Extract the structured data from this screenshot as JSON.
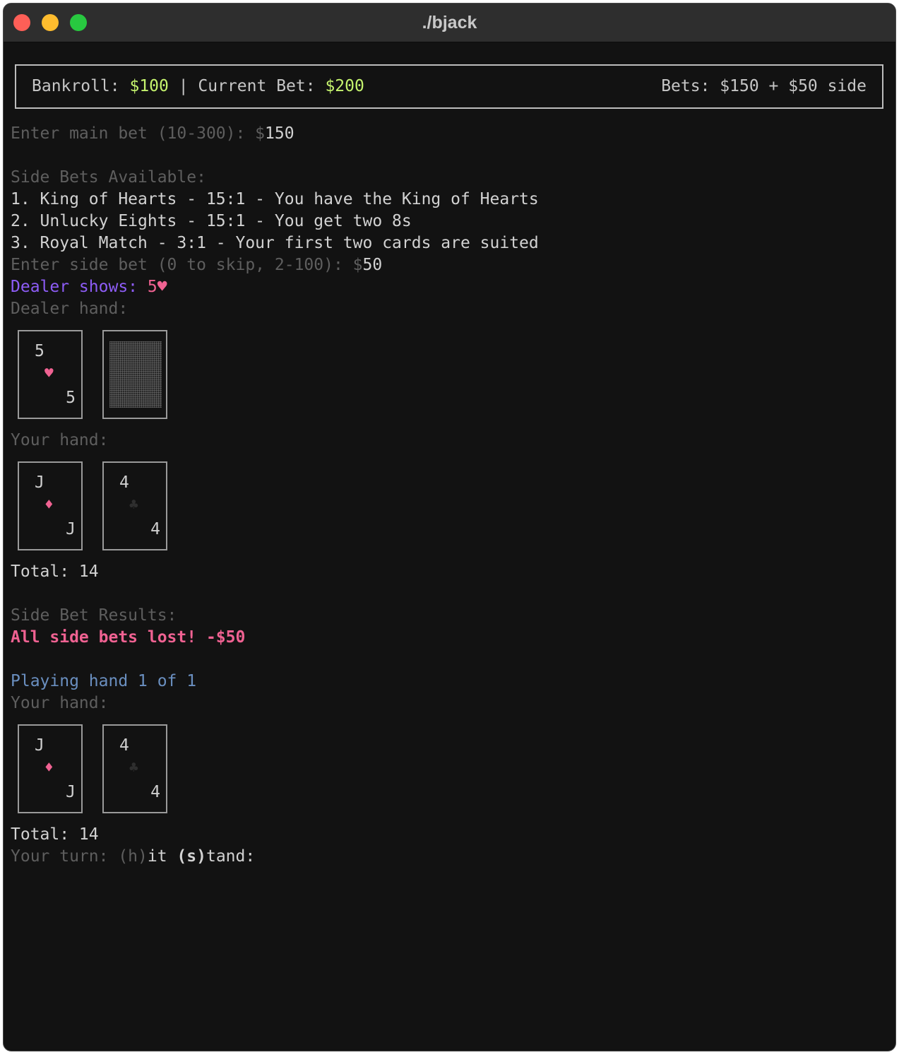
{
  "window": {
    "title": "./bjack"
  },
  "status": {
    "bankroll_label": "Bankroll: ",
    "bankroll_value": "$100",
    "separator": " | ",
    "bet_label": "Current Bet: ",
    "bet_value": "$200",
    "bets_summary": "Bets: $150 + $50 side"
  },
  "prompts": {
    "main_bet_label": "Enter main bet (10-300): $",
    "main_bet_value": "150",
    "side_bets_header": "Side Bets Available:",
    "side_bet_options": [
      "1. King of Hearts - 15:1 - You have the King of Hearts",
      "2. Unlucky Eights - 15:1 - You get two 8s",
      "3. Royal Match - 3:1 - Your first two cards are suited"
    ],
    "side_bet_label": "Enter side bet (0 to skip, 2-100): $",
    "side_bet_value": "50"
  },
  "dealer": {
    "shows_label": "Dealer shows: ",
    "shows_value": "5♥",
    "hand_label": "Dealer hand:",
    "cards": [
      {
        "rank": "5",
        "suit": "♥",
        "suit_color": "#f06292"
      },
      {
        "face_down": true
      }
    ]
  },
  "player": {
    "hand_label": "Your hand:",
    "cards": [
      {
        "rank": "J",
        "suit": "♦",
        "suit_color": "#f06292"
      },
      {
        "rank": "4",
        "suit": "♣",
        "suit_color": "#2e2e2e"
      }
    ],
    "total": "Total: 14"
  },
  "side_bet_results": {
    "header": "Side Bet Results:",
    "message": "All side bets lost! -$50"
  },
  "play": {
    "playing": "Playing hand 1 of 1",
    "hand_label": "Your hand:",
    "cards": [
      {
        "rank": "J",
        "suit": "♦",
        "suit_color": "#f06292"
      },
      {
        "rank": "4",
        "suit": "♣",
        "suit_color": "#2e2e2e"
      }
    ],
    "total": "Total: 14",
    "turn_label": "Your turn: ",
    "hit_key": "(h)",
    "hit_rest": "it ",
    "stand_key": "(s)",
    "stand_rest": "tand:"
  },
  "colors": {
    "accent_green": "#c5f36e",
    "dealer_purple": "#8d5cf6",
    "loss_pink": "#f06292",
    "info_blue": "#6a8fc0"
  }
}
